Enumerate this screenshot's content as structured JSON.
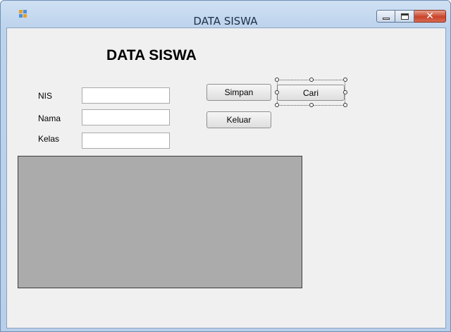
{
  "window": {
    "title": "DATA SISWA",
    "icon": "app-icon",
    "controls": [
      "minimize-icon",
      "maximize-icon",
      "close-icon"
    ],
    "close_glyph": "✕"
  },
  "form": {
    "heading": "DATA SISWA",
    "fields": [
      {
        "label": "NIS",
        "value": ""
      },
      {
        "label": "Nama",
        "value": ""
      },
      {
        "label": "Kelas",
        "value": ""
      }
    ],
    "buttons": {
      "simpan": "Simpan",
      "cari": "Cari",
      "keluar": "Keluar"
    },
    "selected_control": "Cari"
  },
  "colors": {
    "client_background": "#f0f0f0",
    "grid_background": "#ababab",
    "close_button": "#c8442a"
  }
}
